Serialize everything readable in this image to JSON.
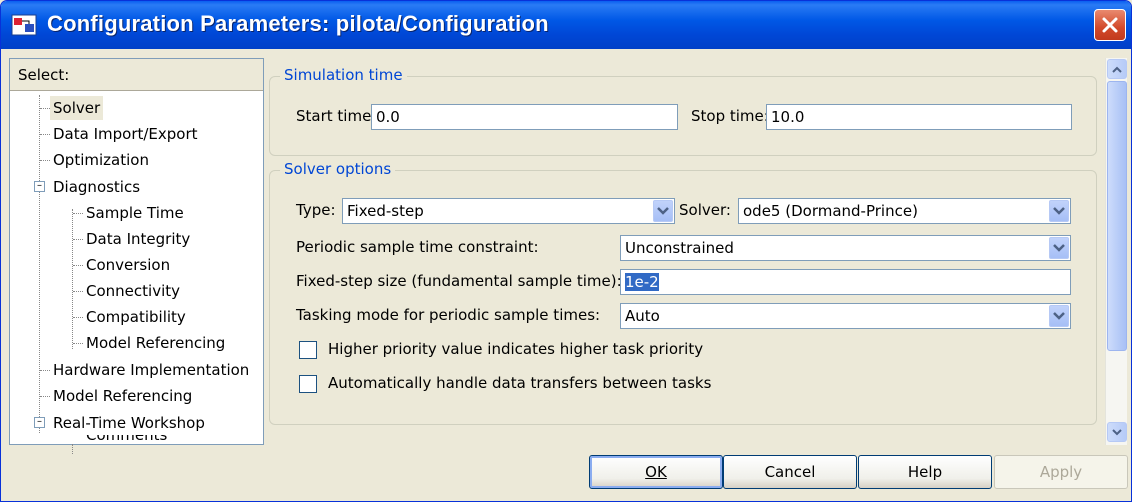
{
  "window": {
    "title": "Configuration Parameters: pilota/Configuration"
  },
  "tree": {
    "header": "Select:",
    "items": [
      {
        "label": "Solver",
        "selected": true
      },
      {
        "label": "Data Import/Export"
      },
      {
        "label": "Optimization"
      },
      {
        "label": "Diagnostics",
        "expander": "minus"
      },
      {
        "label": "Sample Time"
      },
      {
        "label": "Data Integrity"
      },
      {
        "label": "Conversion"
      },
      {
        "label": "Connectivity"
      },
      {
        "label": "Compatibility"
      },
      {
        "label": "Model Referencing"
      },
      {
        "label": "Hardware Implementation"
      },
      {
        "label": "Model Referencing"
      },
      {
        "label": "Real-Time Workshop",
        "expander": "minus"
      },
      {
        "label": "Comments"
      }
    ]
  },
  "simulation_time": {
    "legend": "Simulation time",
    "start_label": "Start time:",
    "start_value": "0.0",
    "stop_label": "Stop time:",
    "stop_value": "10.0"
  },
  "solver_options": {
    "legend": "Solver options",
    "type_label": "Type:",
    "type_value": "Fixed-step",
    "solver_label": "Solver:",
    "solver_value": "ode5 (Dormand-Prince)",
    "periodic_label": "Periodic sample time constraint:",
    "periodic_value": "Unconstrained",
    "step_label": "Fixed-step size (fundamental sample time):",
    "step_value": "1e-2",
    "tasking_label": "Tasking mode for periodic sample times:",
    "tasking_value": "Auto",
    "checkbox1_label": "Higher priority value indicates higher task priority",
    "checkbox1_checked": false,
    "checkbox2_label": "Automatically handle data transfers between tasks",
    "checkbox2_checked": false
  },
  "buttons": {
    "ok": "OK",
    "cancel": "Cancel",
    "help": "Help",
    "apply": "Apply"
  },
  "icons": {
    "app": "simulink-icon",
    "close": "close-icon",
    "dropdown": "chevron-down-icon"
  },
  "colors": {
    "titlebar": "#0054e3",
    "group_label": "#0046d5",
    "selection": "#316ac5",
    "dialog_bg": "#ece9d8"
  }
}
